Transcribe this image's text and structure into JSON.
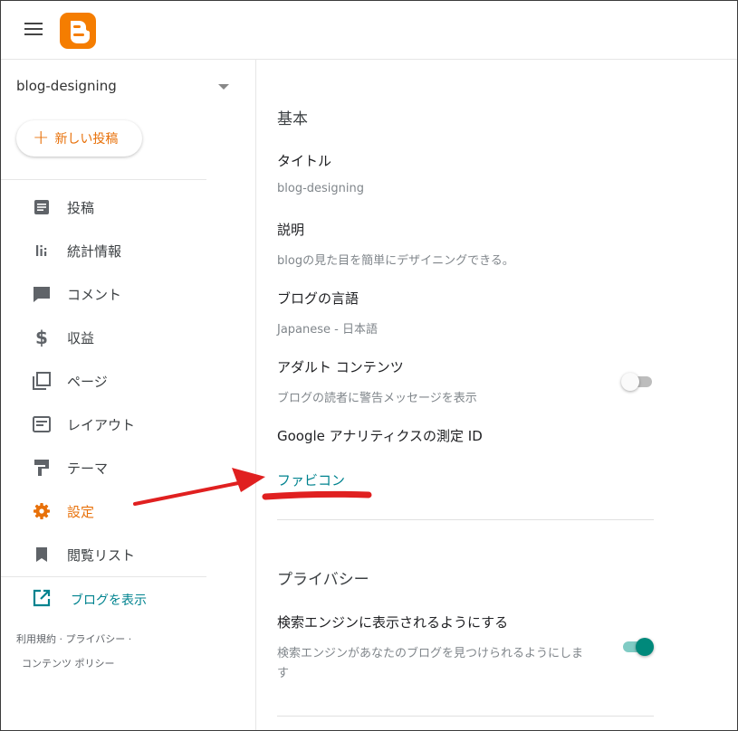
{
  "sidebar": {
    "blog_name": "blog-designing",
    "new_post_label": "新しい投稿",
    "items": [
      {
        "label": "投稿",
        "icon": "posts-icon"
      },
      {
        "label": "統計情報",
        "icon": "stats-icon"
      },
      {
        "label": "コメント",
        "icon": "comment-icon"
      },
      {
        "label": "収益",
        "icon": "dollar-icon"
      },
      {
        "label": "ページ",
        "icon": "pages-icon"
      },
      {
        "label": "レイアウト",
        "icon": "layout-icon"
      },
      {
        "label": "テーマ",
        "icon": "theme-icon"
      },
      {
        "label": "設定",
        "icon": "gear-icon"
      },
      {
        "label": "閲覧リスト",
        "icon": "bookmark-icon"
      }
    ],
    "view_blog_label": "ブログを表示",
    "footer_line1": "利用規約 · プライバシー ·",
    "footer_line2": "コンテンツ ポリシー"
  },
  "main": {
    "basic_title": "基本",
    "title_label": "タイトル",
    "title_value": "blog-designing",
    "description_label": "説明",
    "description_value": "blogの見た目を簡単にデザイニングできる。",
    "language_label": "ブログの言語",
    "language_value": "Japanese - 日本語",
    "adult_label": "アダルト コンテンツ",
    "adult_desc": "ブログの読者に警告メッセージを表示",
    "adult_on": false,
    "analytics_label": "Google アナリティクスの測定 ID",
    "favicon_label": "ファビコン",
    "privacy_title": "プライバシー",
    "search_label": "検索エンジンに表示されるようにする",
    "search_desc_line1": "検索エンジンがあなたのブログを見つけられるようにしま",
    "search_desc_line2": "す",
    "search_on": true
  },
  "colors": {
    "brand": "#f57d00",
    "accent_orange": "#e8710a",
    "link_teal": "#00838f",
    "toggle_on": "#00897b",
    "arrow_red": "#e02020"
  }
}
